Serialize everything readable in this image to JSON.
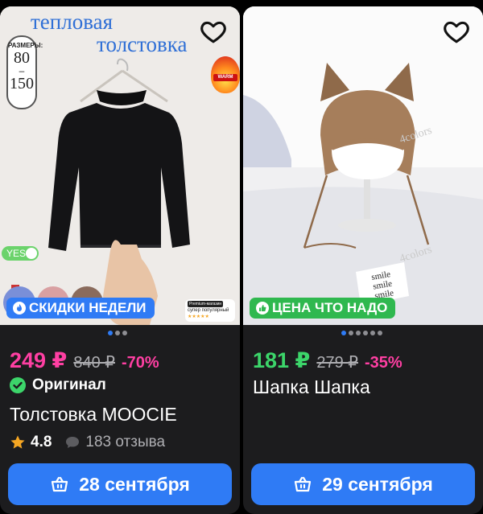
{
  "products": [
    {
      "photo": {
        "watermark_line1": "тепловая",
        "watermark_line2": "толстовка",
        "sizes_header": "РАЗМЕРЫ:",
        "sizes_from": "80",
        "sizes_dash": "–",
        "sizes_to": "150",
        "flame_label": "WARM",
        "yes_label": "YES",
        "promo": {
          "tag": "Premium-магазин",
          "text": "супер популярный",
          "stars": "★★★★★"
        }
      },
      "badge": {
        "label": "СКИДКИ НЕДЕЛИ",
        "icon": "fire-icon",
        "color": "#2f7bf5"
      },
      "carousel": {
        "count": 3,
        "active": 1
      },
      "price": "249 ₽",
      "old_price": "840 ₽",
      "discount": "-70%",
      "original_label": "Оригинал",
      "title": "Толстовка MOOCIE",
      "rating": "4.8",
      "reviews": "183 отзыва",
      "delivery": "28 сентября"
    },
    {
      "photo": {
        "watermark": "4colors",
        "stand_text": "smile smile smile"
      },
      "badge": {
        "label": "ЦЕНА ЧТО НАДО",
        "icon": "thumbs-up-icon",
        "color": "#2fb84f"
      },
      "carousel": {
        "count": 6,
        "active": 1
      },
      "price": "181 ₽",
      "old_price": "279 ₽",
      "discount": "-35%",
      "title": "Шапка Шапка",
      "delivery": "29 сентября"
    }
  ],
  "colors": {
    "accent": "#2f7bf5",
    "price_pink": "#ff3fa3",
    "price_green": "#3cd56a",
    "badge_green": "#2fb84f"
  }
}
